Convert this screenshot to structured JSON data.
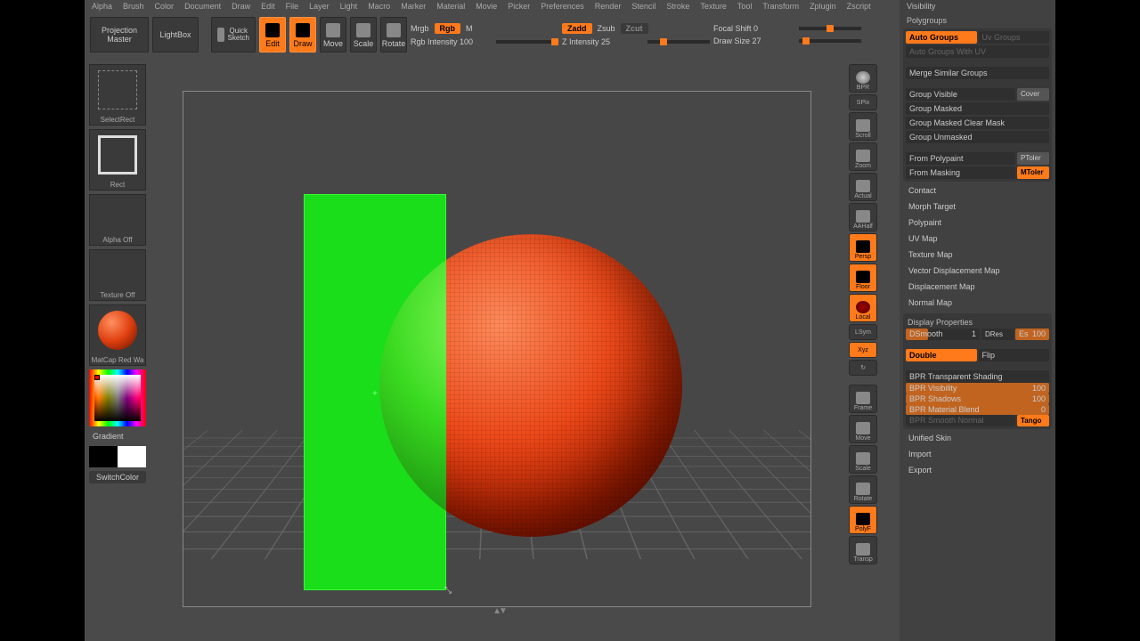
{
  "menubar": [
    "Alpha",
    "Brush",
    "Color",
    "Document",
    "Draw",
    "Edit",
    "File",
    "Layer",
    "Light",
    "Macro",
    "Marker",
    "Material",
    "Movie",
    "Picker",
    "Preferences",
    "Render",
    "Stencil",
    "Stroke",
    "Texture",
    "Tool",
    "Transform",
    "Zplugin",
    "Zscript"
  ],
  "toolbar": {
    "projection_master": "Projection Master",
    "lightbox": "LightBox",
    "quick_sketch": "Quick Sketch",
    "edit": "Edit",
    "draw": "Draw",
    "move": "Move",
    "scale": "Scale",
    "rotate": "Rotate",
    "mrgb": "Mrgb",
    "rgb": "Rgb",
    "m": "M",
    "rgb_intensity_label": "Rgb Intensity",
    "rgb_intensity_value": "100",
    "zadd": "Zadd",
    "zsub": "Zsub",
    "zcut": "Zcut",
    "z_intensity_label": "Z Intensity",
    "z_intensity_value": "25",
    "focal_shift_label": "Focal Shift",
    "focal_shift_value": "0",
    "draw_size_label": "Draw Size",
    "draw_size_value": "27"
  },
  "left": {
    "select_rect": "SelectRect",
    "rect": "Rect",
    "alpha_off": "Alpha Off",
    "texture_off": "Texture Off",
    "matcap": "MatCap Red Wa",
    "gradient": "Gradient",
    "switch_color": "SwitchColor"
  },
  "dock": {
    "bpr": "BPR",
    "spix": "SPix",
    "scroll": "Scroll",
    "zoom": "Zoom",
    "actual": "Actual",
    "aahalf": "AAHalf",
    "persp": "Persp",
    "floor": "Floor",
    "local": "Local",
    "lsym": "LSym",
    "xyz": "Xyz",
    "rot": "↻",
    "frame": "Frame",
    "move": "Move",
    "scale": "Scale",
    "rotate": "Rotate",
    "polyf": "PolyF",
    "transp": "Transp"
  },
  "right": {
    "visibility": "Visibility",
    "polygroups": "Polygroups",
    "auto_groups": "Auto Groups",
    "uv_groups": "Uv Groups",
    "auto_groups_uv": "Auto Groups With UV",
    "merge_similar": "Merge Similar Groups",
    "group_visible": "Group Visible",
    "cover": "Cover",
    "group_masked": "Group Masked",
    "group_masked_clear": "Group Masked Clear Mask",
    "group_unmasked": "Group Unmasked",
    "from_polypaint": "From Polypaint",
    "ptoler": "PToler",
    "from_masking": "From Masking",
    "mtoler": "MToler",
    "contact": "Contact",
    "morph_target": "Morph Target",
    "polypaint": "Polypaint",
    "uv_map": "UV Map",
    "texture_map": "Texture Map",
    "vdisp_map": "Vector Displacement Map",
    "disp_map": "Displacement Map",
    "normal_map": "Normal Map",
    "display_props": "Display Properties",
    "dsmooth": "DSmooth",
    "dsmooth_val": "1",
    "dres": "DRes",
    "es": "Es",
    "es_val": "100",
    "double": "Double",
    "flip": "Flip",
    "bpr_trans": "BPR Transparent Shading",
    "bpr_vis": "BPR Visibility",
    "bpr_vis_val": "100",
    "bpr_shadows": "BPR Shadows",
    "bpr_shadows_val": "100",
    "bpr_material": "BPR Material Blend",
    "bpr_material_val": "0",
    "bpr_smooth": "BPR Smooth Normal",
    "tango": "Tango",
    "unified_skin": "Unified Skin",
    "import": "Import",
    "export": "Export"
  }
}
